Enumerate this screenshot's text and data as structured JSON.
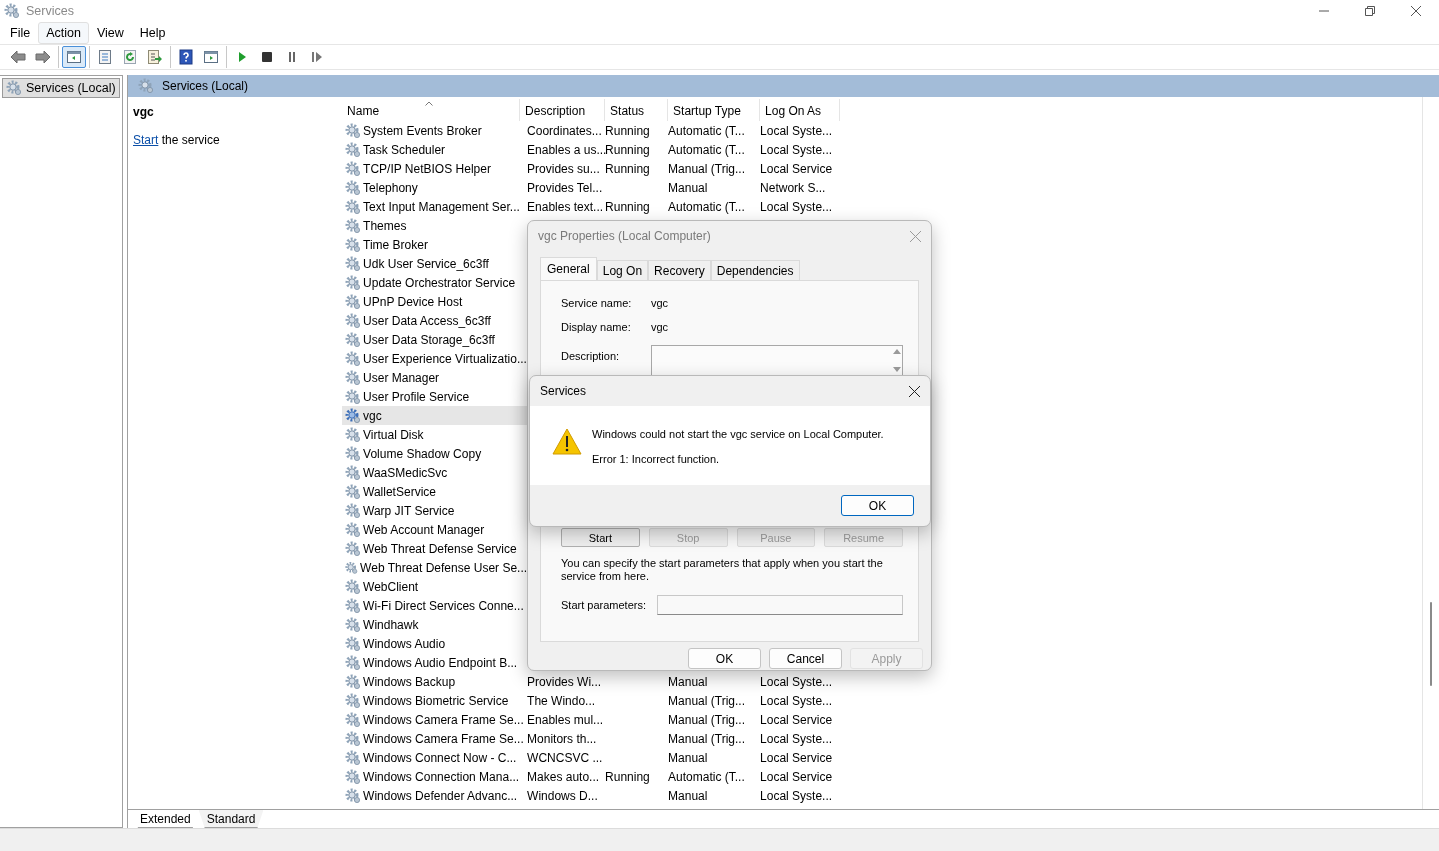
{
  "window": {
    "title": "Services"
  },
  "menu": [
    {
      "label": "File",
      "selected": false
    },
    {
      "label": "Action",
      "selected": true
    },
    {
      "label": "View",
      "selected": false
    },
    {
      "label": "Help",
      "selected": false
    }
  ],
  "toolbar_groups": [
    [
      {
        "kind": "back",
        "pressed": false
      },
      {
        "kind": "forward",
        "pressed": false
      }
    ],
    [
      {
        "kind": "console-tree",
        "pressed": true
      }
    ],
    [
      {
        "kind": "properties",
        "pressed": false
      },
      {
        "kind": "refresh",
        "pressed": false
      },
      {
        "kind": "export",
        "pressed": false
      }
    ],
    [
      {
        "kind": "help",
        "pressed": false
      },
      {
        "kind": "action-pane",
        "pressed": false
      }
    ],
    [
      {
        "kind": "start",
        "pressed": false
      },
      {
        "kind": "stop",
        "pressed": false
      },
      {
        "kind": "pause",
        "pressed": false
      },
      {
        "kind": "resume",
        "pressed": false
      }
    ]
  ],
  "tree": {
    "items": [
      {
        "label": "Services (Local)",
        "selected": true
      }
    ]
  },
  "pane_header": {
    "title": "Services (Local)"
  },
  "details": {
    "service": "vgc",
    "link": "Start",
    "link_rest": "the service"
  },
  "table": {
    "columns": [
      "Name",
      "Description",
      "Status",
      "Startup Type",
      "Log On As"
    ],
    "rows": [
      {
        "name": "System Events Broker",
        "description": "Coordinates...",
        "status": "Running",
        "startup": "Automatic (T...",
        "logon": "Local Syste...",
        "selected": false
      },
      {
        "name": "Task Scheduler",
        "description": "Enables a us...",
        "status": "Running",
        "startup": "Automatic (T...",
        "logon": "Local Syste...",
        "selected": false
      },
      {
        "name": "TCP/IP NetBIOS Helper",
        "description": "Provides su...",
        "status": "Running",
        "startup": "Manual (Trig...",
        "logon": "Local Service",
        "selected": false
      },
      {
        "name": "Telephony",
        "description": "Provides Tel...",
        "startup": "Manual",
        "logon": "Network S...",
        "selected": false
      },
      {
        "name": "Text Input Management Ser...",
        "description": "Enables text...",
        "status": "Running",
        "startup": "Automatic (T...",
        "logon": "Local Syste...",
        "selected": false
      },
      {
        "name": "Themes",
        "selected": false
      },
      {
        "name": "Time Broker",
        "selected": false
      },
      {
        "name": "Udk User Service_6c3ff",
        "selected": false
      },
      {
        "name": "Update Orchestrator Service",
        "selected": false
      },
      {
        "name": "UPnP Device Host",
        "selected": false
      },
      {
        "name": "User Data Access_6c3ff",
        "selected": false
      },
      {
        "name": "User Data Storage_6c3ff",
        "selected": false
      },
      {
        "name": "User Experience Virtualizatio...",
        "selected": false
      },
      {
        "name": "User Manager",
        "selected": false
      },
      {
        "name": "User Profile Service",
        "selected": false
      },
      {
        "name": "vgc",
        "selected": true
      },
      {
        "name": "Virtual Disk",
        "selected": false
      },
      {
        "name": "Volume Shadow Copy",
        "selected": false
      },
      {
        "name": "WaaSMedicSvc",
        "selected": false
      },
      {
        "name": "WalletService",
        "selected": false
      },
      {
        "name": "Warp JIT Service",
        "selected": false
      },
      {
        "name": "Web Account Manager",
        "selected": false
      },
      {
        "name": "Web Threat Defense Service",
        "selected": false
      },
      {
        "name": "Web Threat Defense User Se...",
        "selected": false
      },
      {
        "name": "WebClient",
        "selected": false
      },
      {
        "name": "Wi-Fi Direct Services Conne...",
        "selected": false
      },
      {
        "name": "Windhawk",
        "selected": false
      },
      {
        "name": "Windows Audio",
        "selected": false
      },
      {
        "name": "Windows Audio Endpoint B...",
        "selected": false
      },
      {
        "name": "Windows Backup",
        "description": "Provides Wi...",
        "startup": "Manual",
        "logon": "Local Syste...",
        "selected": false
      },
      {
        "name": "Windows Biometric Service",
        "description": "The Windo...",
        "startup": "Manual (Trig...",
        "logon": "Local Syste...",
        "selected": false
      },
      {
        "name": "Windows Camera Frame Se...",
        "description": "Enables mul...",
        "startup": "Manual (Trig...",
        "logon": "Local Service",
        "selected": false
      },
      {
        "name": "Windows Camera Frame Se...",
        "description": "Monitors th...",
        "startup": "Manual (Trig...",
        "logon": "Local Syste...",
        "selected": false
      },
      {
        "name": "Windows Connect Now - C...",
        "description": "WCNCSVC ...",
        "startup": "Manual",
        "logon": "Local Service",
        "selected": false
      },
      {
        "name": "Windows Connection Mana...",
        "description": "Makes auto...",
        "status": "Running",
        "startup": "Automatic (T...",
        "logon": "Local Service",
        "selected": false
      },
      {
        "name": "Windows Defender Advanc...",
        "description": "Windows D...",
        "startup": "Manual",
        "logon": "Local Syste...",
        "selected": false
      }
    ]
  },
  "view_tabs": [
    {
      "label": "Extended",
      "selected": true
    },
    {
      "label": "Standard",
      "selected": false
    }
  ],
  "properties_dialog": {
    "title": "vgc Properties (Local Computer)",
    "tabs": [
      {
        "label": "General",
        "selected": true
      },
      {
        "label": "Log On",
        "selected": false
      },
      {
        "label": "Recovery",
        "selected": false
      },
      {
        "label": "Dependencies",
        "selected": false
      }
    ],
    "fields": [
      {
        "label": "Service name:",
        "value": "vgc"
      },
      {
        "label": "Display name:",
        "value": "vgc"
      }
    ],
    "description_label": "Description:",
    "control_buttons": [
      {
        "label": "Start",
        "disabled": false
      },
      {
        "label": "Stop",
        "disabled": true
      },
      {
        "label": "Pause",
        "disabled": true
      },
      {
        "label": "Resume",
        "disabled": true
      }
    ],
    "hint": "You can specify the start parameters that apply when you start the service from here.",
    "params_label": "Start parameters:",
    "buttons": [
      {
        "label": "OK",
        "disabled": false
      },
      {
        "label": "Cancel",
        "disabled": false
      },
      {
        "label": "Apply",
        "disabled": true
      }
    ]
  },
  "error_dialog": {
    "title": "Services",
    "message": "Windows could not start the vgc service on Local Computer.",
    "error": "Error 1: Incorrect function.",
    "button": "OK"
  }
}
